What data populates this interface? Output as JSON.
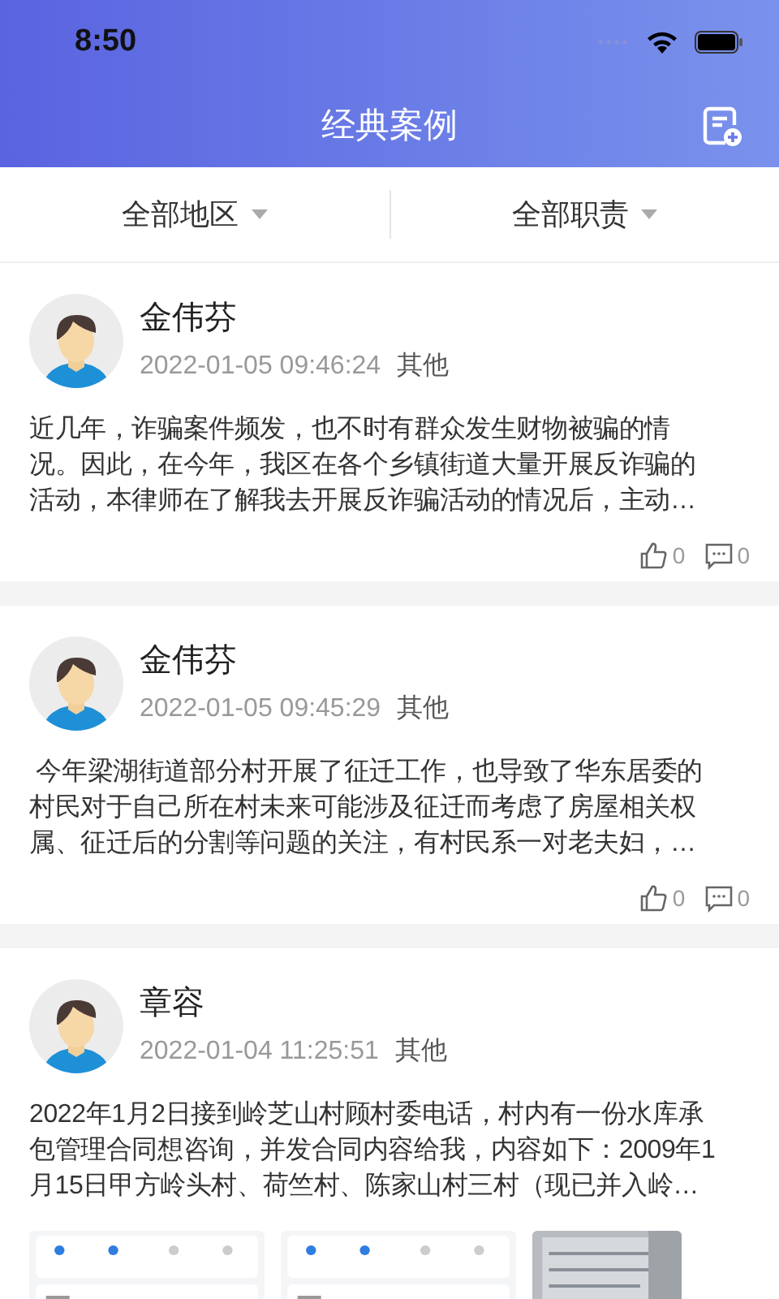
{
  "status_bar": {
    "time": "8:50"
  },
  "header": {
    "title": "经典案例"
  },
  "filters": [
    {
      "label": "全部地区"
    },
    {
      "label": "全部职责"
    }
  ],
  "cases": [
    {
      "name": "金伟芬",
      "datetime": "2022-01-05 09:46:24",
      "category": "其他",
      "body_lines": [
        "近几年，诈骗案件频发，也不时有群众发生财物被骗的情",
        "况。因此，在今年，我区在各个乡镇街道大量开展反诈骗的",
        "活动，本律师在了解我去开展反诈骗活动的情况后，主动…"
      ],
      "likes": "0",
      "comments": "0"
    },
    {
      "name": "金伟芬",
      "datetime": "2022-01-05 09:45:29",
      "category": "其他",
      "body_lines": [
        " 今年梁湖街道部分村开展了征迁工作，也导致了华东居委的",
        "村民对于自己所在村未来可能涉及征迁而考虑了房屋相关权",
        "属、征迁后的分割等问题的关注，有村民系一对老夫妇，…"
      ],
      "likes": "0",
      "comments": "0"
    },
    {
      "name": "章容",
      "datetime": "2022-01-04 11:25:51",
      "category": "其他",
      "body_lines": [
        "2022年1月2日接到岭芝山村顾村委电话，村内有一份水库承",
        "包管理合同想咨询，并发合同内容给我，内容如下：2009年1",
        "月15日甲方岭头村、荷竺村、陈家山村三村（现已并入岭…"
      ]
    }
  ]
}
